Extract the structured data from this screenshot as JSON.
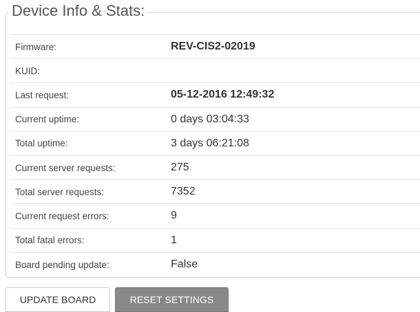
{
  "panel": {
    "title": "Device Info & Stats:"
  },
  "stats": [
    {
      "label": "Firmware:",
      "value": "REV-CIS2-02019",
      "bold": true
    },
    {
      "label": "KUID:",
      "value": "",
      "bold": false
    },
    {
      "label": "Last request:",
      "value": "05-12-2016 12:49:32",
      "bold": true
    },
    {
      "label": "Current uptime:",
      "value": "0 days 03:04:33",
      "bold": false
    },
    {
      "label": "Total uptime:",
      "value": "3 days 06:21:08",
      "bold": false
    },
    {
      "label": "Current server requests:",
      "value": "275",
      "bold": false
    },
    {
      "label": "Total server requests:",
      "value": "7352",
      "bold": false
    },
    {
      "label": "Current request errors:",
      "value": "9",
      "bold": false
    },
    {
      "label": "Total fatal errors:",
      "value": "1",
      "bold": false
    },
    {
      "label": "Board pending update:",
      "value": "False",
      "bold": false
    }
  ],
  "buttons": {
    "update_label": "UPDATE BOARD",
    "reset_label": "RESET SETTINGS"
  }
}
